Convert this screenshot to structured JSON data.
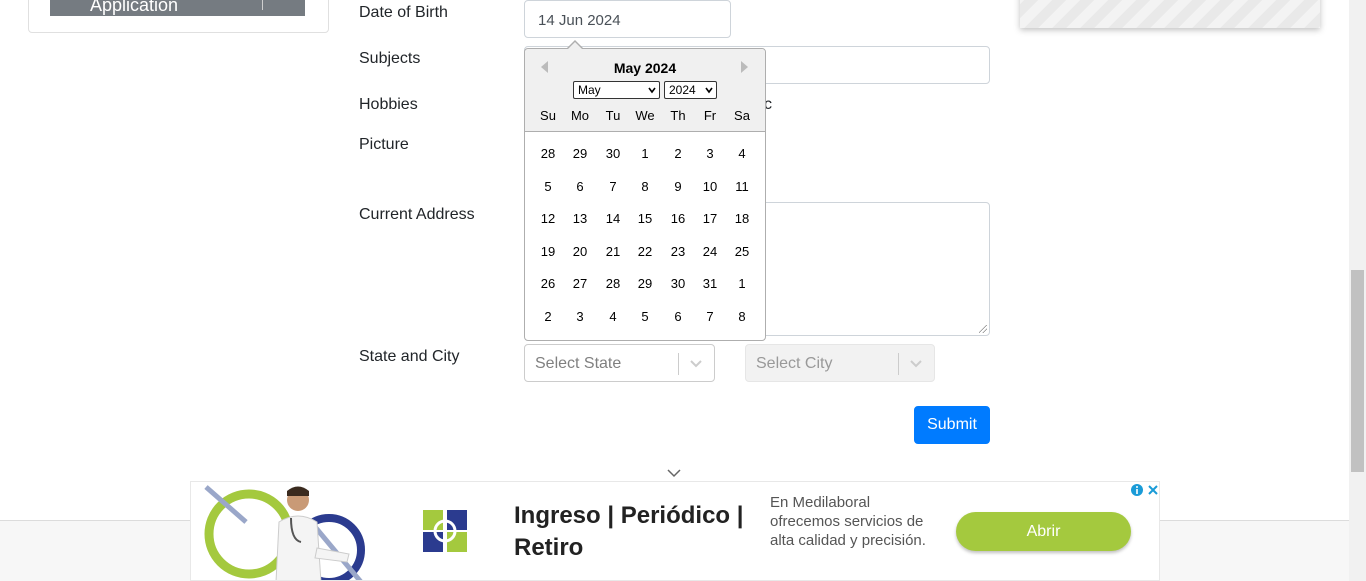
{
  "sidebar": {
    "active_item_label": "Application"
  },
  "form": {
    "date_of_birth_label": "Date of Birth",
    "date_of_birth_value": "14 Jun 2024",
    "subjects_label": "Subjects",
    "hobbies_label": "Hobbies",
    "hobbies_visible_tail": "c",
    "picture_label": "Picture",
    "current_address_label": "Current Address",
    "state_city_label": "State and City",
    "state_placeholder": "Select State",
    "city_placeholder": "Select City",
    "submit_label": "Submit"
  },
  "datepicker": {
    "title": "May 2024",
    "month_selected": "May",
    "year_selected": "2024",
    "day_names": [
      "Su",
      "Mo",
      "Tu",
      "We",
      "Th",
      "Fr",
      "Sa"
    ],
    "weeks": [
      [
        "28",
        "29",
        "30",
        "1",
        "2",
        "3",
        "4"
      ],
      [
        "5",
        "6",
        "7",
        "8",
        "9",
        "10",
        "11"
      ],
      [
        "12",
        "13",
        "14",
        "15",
        "16",
        "17",
        "18"
      ],
      [
        "19",
        "20",
        "21",
        "22",
        "23",
        "24",
        "25"
      ],
      [
        "26",
        "27",
        "28",
        "29",
        "30",
        "31",
        "1"
      ],
      [
        "2",
        "3",
        "4",
        "5",
        "6",
        "7",
        "8"
      ]
    ]
  },
  "ad": {
    "headline": "Ingreso | Periódico | Retiro",
    "description": "En Medilaboral ofrecemos servicios de alta calidad y precisión.",
    "cta_label": "Abrir",
    "accent_color": "#a4c93e"
  },
  "colors": {
    "primary_button": "#007bff",
    "input_border": "#ced4da"
  }
}
